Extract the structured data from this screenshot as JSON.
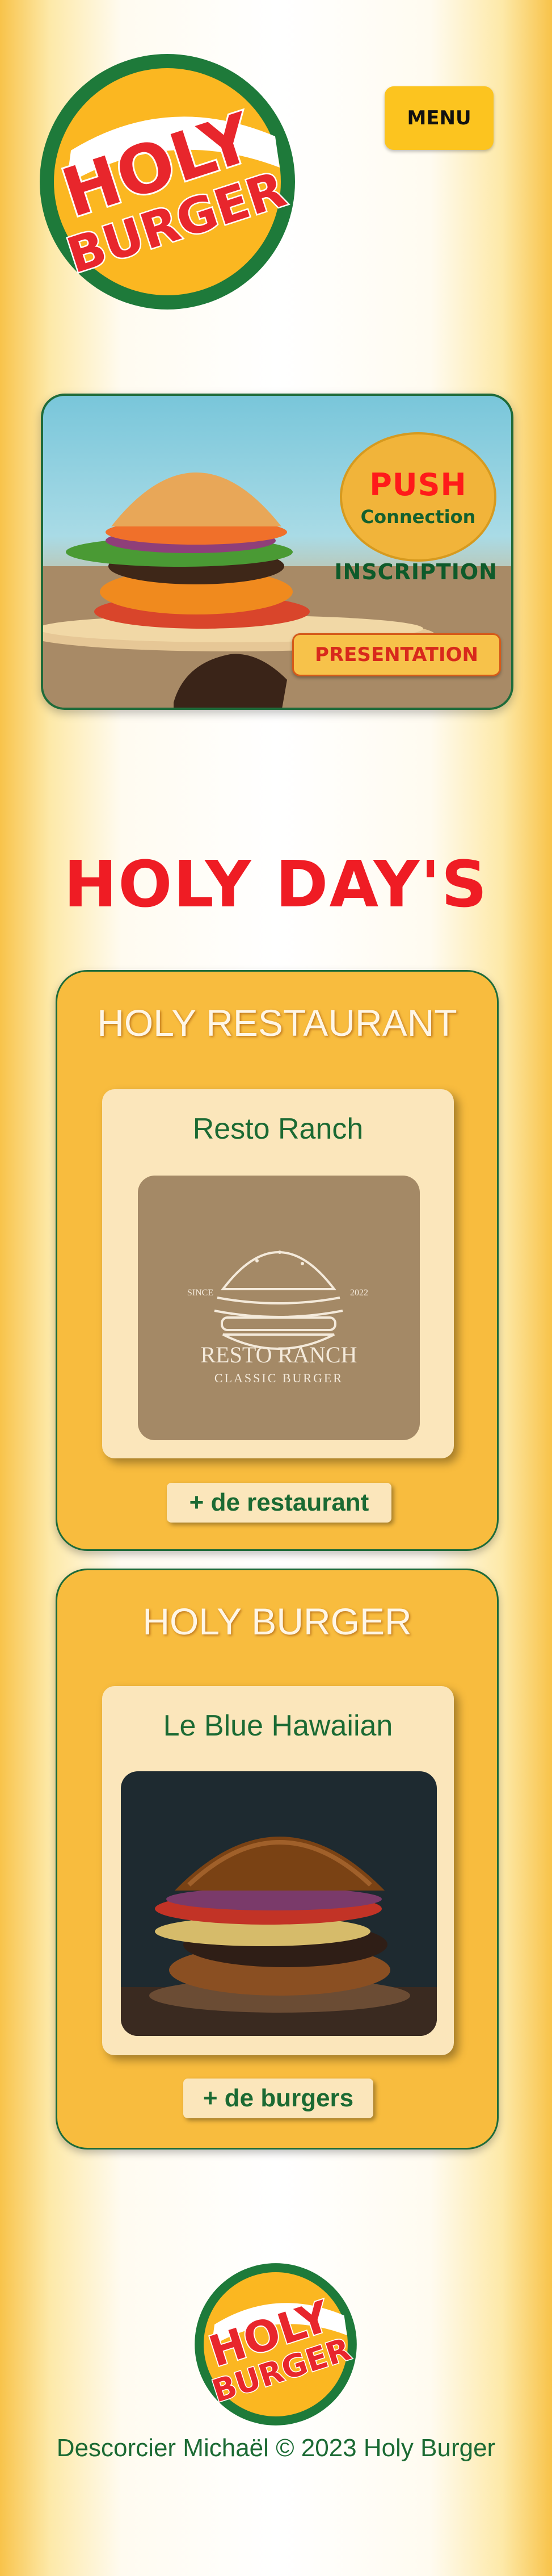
{
  "header": {
    "logo_line1": "HOLY",
    "logo_line2": "BURGER",
    "menu_label": "MENU"
  },
  "hero": {
    "push_title": "PUSH",
    "push_sub": "Connection",
    "inscription": "INSCRIPTION",
    "presentation": "PRESENTATION"
  },
  "section": {
    "title": "HOLY DAY'S"
  },
  "cards": [
    {
      "title": "HOLY RESTAURANT",
      "item_title": "Resto Ranch",
      "image": {
        "since": "SINCE",
        "year": "2022",
        "name": "RESTO RANCH",
        "tagline": "CLASSIC BURGER"
      },
      "button": "+ de restaurant"
    },
    {
      "title": "HOLY BURGER",
      "item_title": "Le Blue Hawaiian",
      "button": "+ de burgers"
    }
  ],
  "footer": {
    "logo_line1": "HOLY",
    "logo_line2": "BURGER",
    "copyright": "Descorcier Michaël © 2023 Holy Burger"
  },
  "colors": {
    "brand_red": "#ef1c24",
    "brand_green": "#1e6b3a",
    "brand_yellow": "#f8bc3e",
    "menu_yellow": "#fcc41f"
  }
}
